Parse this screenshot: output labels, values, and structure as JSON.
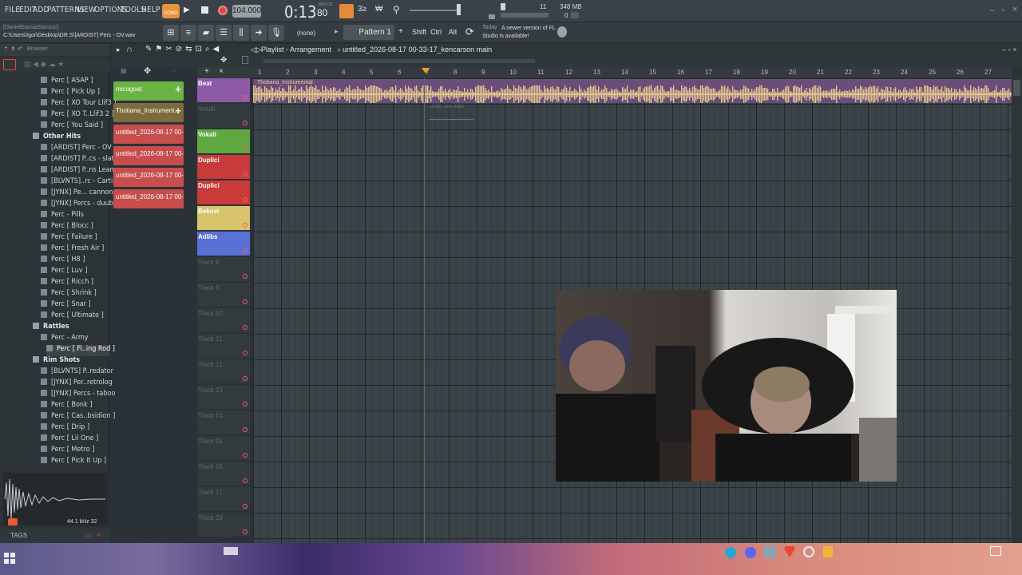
{
  "menu": [
    "FILE",
    "EDIT",
    "ADD",
    "PATTERNS",
    "VIEW",
    "OPTIONS",
    "TOOLS",
    "HELP"
  ],
  "transport": {
    "mode": "SONG",
    "tempo": "104.000",
    "time": "0:13",
    "time_sub": "80",
    "time_unit": "M:S:CS",
    "cpu_value": "11",
    "memory": "348 MB",
    "polyphony": "0"
  },
  "user": "[DanielGarciaStanicic]",
  "filepath": "C:\\Users\\Igor\\Desktop\\DR.S\\[ARDIST] Perc - OV.wav",
  "toolbar2": {
    "pattern_none": "(none)",
    "pattern": "Pattern 1",
    "shift": "Shift",
    "ctrl": "Ctrl",
    "alt": "Alt",
    "news_date": "Today",
    "news_text": "A newer version of FL Studio is available!"
  },
  "browser": {
    "title": "Browser",
    "items": [
      {
        "label": "Perc [ ASAP ]",
        "type": "file"
      },
      {
        "label": "Perc [ Pick Up ]",
        "type": "file"
      },
      {
        "label": "Perc [ XO Tour Llif3 ]",
        "type": "file"
      },
      {
        "label": "Perc [ XO T..Llif3 2 ]",
        "type": "file"
      },
      {
        "label": "Perc [ You Said ]",
        "type": "file"
      },
      {
        "label": "Other Hits",
        "type": "folder"
      },
      {
        "label": "[ARDIST] Perc - OV",
        "type": "file"
      },
      {
        "label": "[ARDIST] P..cs - slatt",
        "type": "file"
      },
      {
        "label": "[ARDIST] P..ns Lean",
        "type": "file"
      },
      {
        "label": "[BLVNTS]..rc - Carti",
        "type": "file"
      },
      {
        "label": "[JYNX] Pe... cannon",
        "type": "file"
      },
      {
        "label": "[JYNX] Percs - duubi",
        "type": "file"
      },
      {
        "label": "Perc - Pills",
        "type": "file"
      },
      {
        "label": "Perc [ Blocc ]",
        "type": "file"
      },
      {
        "label": "Perc [ Failure ]",
        "type": "file"
      },
      {
        "label": "Perc [ Fresh Air ]",
        "type": "file"
      },
      {
        "label": "Perc [ H8 ]",
        "type": "file"
      },
      {
        "label": "Perc [ Luv ]",
        "type": "file"
      },
      {
        "label": "Perc [ Ricch ]",
        "type": "file"
      },
      {
        "label": "Perc [ Shrink ]",
        "type": "file"
      },
      {
        "label": "Perc [ Snar ]",
        "type": "file"
      },
      {
        "label": "Perc [ Ultimate ]",
        "type": "file"
      },
      {
        "label": "Rattles",
        "type": "folder"
      },
      {
        "label": "Perc - Army",
        "type": "file"
      },
      {
        "label": "Perc [ Fi..ing Rod ]",
        "type": "file",
        "selected": true
      },
      {
        "label": "Rim Shots",
        "type": "folder"
      },
      {
        "label": "[BLVNTS] P..redator",
        "type": "file"
      },
      {
        "label": "[JYNX] Per..retrolog",
        "type": "file"
      },
      {
        "label": "[JYNX] Percs - taboo",
        "type": "file"
      },
      {
        "label": "Perc [ Bonk ]",
        "type": "file"
      },
      {
        "label": "Perc [ Cas..bsidion ]",
        "type": "file"
      },
      {
        "label": "Perc [ Drip ]",
        "type": "file"
      },
      {
        "label": "Perc [ Lil One ]",
        "type": "file"
      },
      {
        "label": "Perc [ Metro ]",
        "type": "file"
      },
      {
        "label": "Perc [ Pick It Up ]",
        "type": "file"
      }
    ],
    "sample_info": "44.1 kHz 32",
    "tags_label": "TAGS"
  },
  "playlist": {
    "title": "Playlist - Arrangement",
    "project": "untitled_2026-08-17 00-33-17_kencarson main"
  },
  "channels": [
    {
      "label": "micogoat",
      "color": "#6bb344"
    },
    {
      "label": "Thotiana_Instrument..",
      "color": "#7d6a3f"
    },
    {
      "label": "untitled_2026-08-17 00-..",
      "color": "#c84d4d"
    },
    {
      "label": "untitled_2026-08-17 00-..",
      "color": "#c84d4d"
    },
    {
      "label": "untitled_2026-08-17 00-..",
      "color": "#c84d4d"
    },
    {
      "label": "untitled_2026-08-17 00-..",
      "color": "#c84d4d"
    }
  ],
  "tracks": [
    {
      "label": "Beat",
      "color": "#8d5aa8"
    },
    {
      "label": "Vokali",
      "color": ""
    },
    {
      "label": "Vokali",
      "color": "#5fa83f"
    },
    {
      "label": "Duplici",
      "color": "#c93a3a"
    },
    {
      "label": "Duplici",
      "color": "#c93a3a"
    },
    {
      "label": "Bekovi",
      "color": "#d8c46a"
    },
    {
      "label": "Adlibs",
      "color": "#5970d6"
    },
    {
      "label": "Track 8",
      "color": ""
    },
    {
      "label": "Track 9",
      "color": ""
    },
    {
      "label": "Track 10",
      "color": ""
    },
    {
      "label": "Track 11",
      "color": ""
    },
    {
      "label": "Track 12",
      "color": ""
    },
    {
      "label": "Track 13",
      "color": ""
    },
    {
      "label": "Track 14",
      "color": ""
    },
    {
      "label": "Track 15",
      "color": ""
    },
    {
      "label": "Track 16",
      "color": ""
    },
    {
      "label": "Track 17",
      "color": ""
    },
    {
      "label": "Track 18",
      "color": ""
    }
  ],
  "ruler_numbers": [
    "1",
    "2",
    "3",
    "4",
    "5",
    "6",
    "7",
    "8",
    "9",
    "10",
    "11",
    "12",
    "13",
    "14",
    "15",
    "16",
    "17",
    "18",
    "19",
    "20",
    "21",
    "22",
    "23",
    "24",
    "25",
    "26",
    "27"
  ],
  "clips": {
    "beat": "Thotiana_Instrumental",
    "vokali": "untitl...son main"
  }
}
